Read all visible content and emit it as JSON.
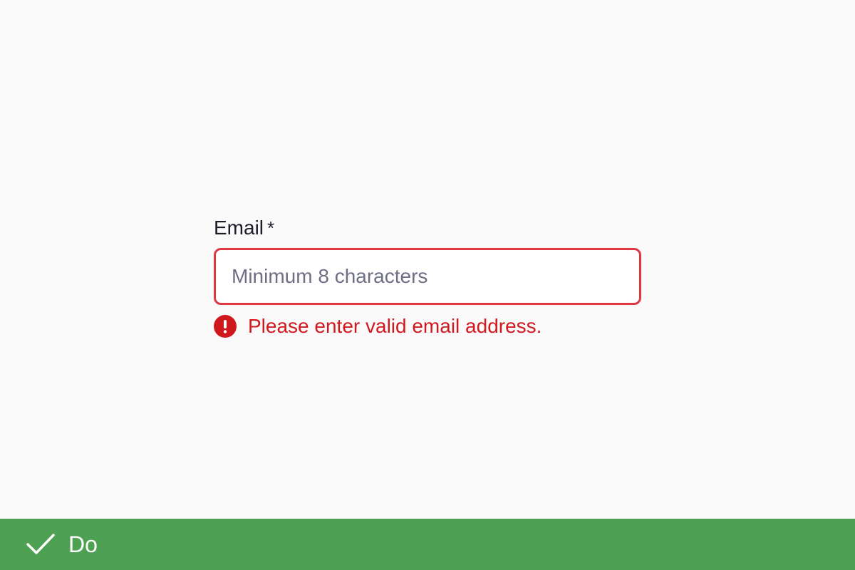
{
  "form": {
    "email_label": "Email",
    "required_marker": "*",
    "email_placeholder": "Minimum 8 characters",
    "email_value": "",
    "error_message": "Please enter valid email address."
  },
  "banner": {
    "label": "Do",
    "icon": "check-icon"
  },
  "colors": {
    "background": "#fafafa",
    "error": "#d0191e",
    "input_border_error": "#e0383e",
    "banner": "#4ea152",
    "text": "#1c1c28",
    "placeholder": "#6e6e85"
  }
}
